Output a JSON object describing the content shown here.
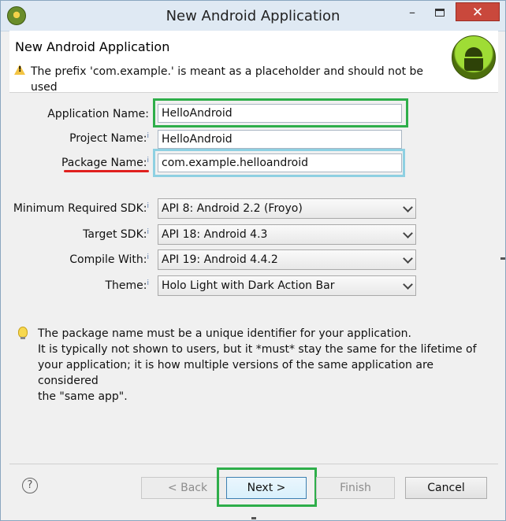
{
  "window": {
    "title": "New Android Application",
    "minimize_glyph": "–",
    "close_glyph": "✕"
  },
  "header": {
    "title": "New Android Application",
    "message": "The prefix 'com.example.' is meant as a placeholder and should not be used",
    "warning_icon": "warning-icon",
    "logo_icon": "android-logo"
  },
  "form": {
    "application_name": {
      "label": "Application Name:",
      "value": "HelloAndroid"
    },
    "project_name": {
      "label": "Project Name:",
      "value": "HelloAndroid"
    },
    "package_name": {
      "label": "Package Name:",
      "value": "com.example.helloandroid"
    },
    "min_sdk": {
      "label": "Minimum Required SDK:",
      "value": "API 8: Android 2.2 (Froyo)"
    },
    "target_sdk": {
      "label": "Target SDK:",
      "value": "API 18: Android 4.3"
    },
    "compile_with": {
      "label": "Compile With:",
      "value": "API 19: Android 4.4.2"
    },
    "theme": {
      "label": "Theme:",
      "value": "Holo Light with Dark Action Bar"
    }
  },
  "info": {
    "lines": [
      "The package name must be a unique identifier for your application.",
      "It is typically not shown to users, but it *must* stay the same for the lifetime of",
      "your application; it is how multiple versions of the same application are considered",
      "the \"same app\"."
    ]
  },
  "buttons": {
    "help": "?",
    "back": "< Back",
    "next": "Next >",
    "finish": "Finish",
    "cancel": "Cancel"
  },
  "colors": {
    "highlight_green": "#2eae4a",
    "highlight_blue": "#8ed0e2",
    "underline_red": "#e0201e",
    "close_button": "#c9483c"
  }
}
